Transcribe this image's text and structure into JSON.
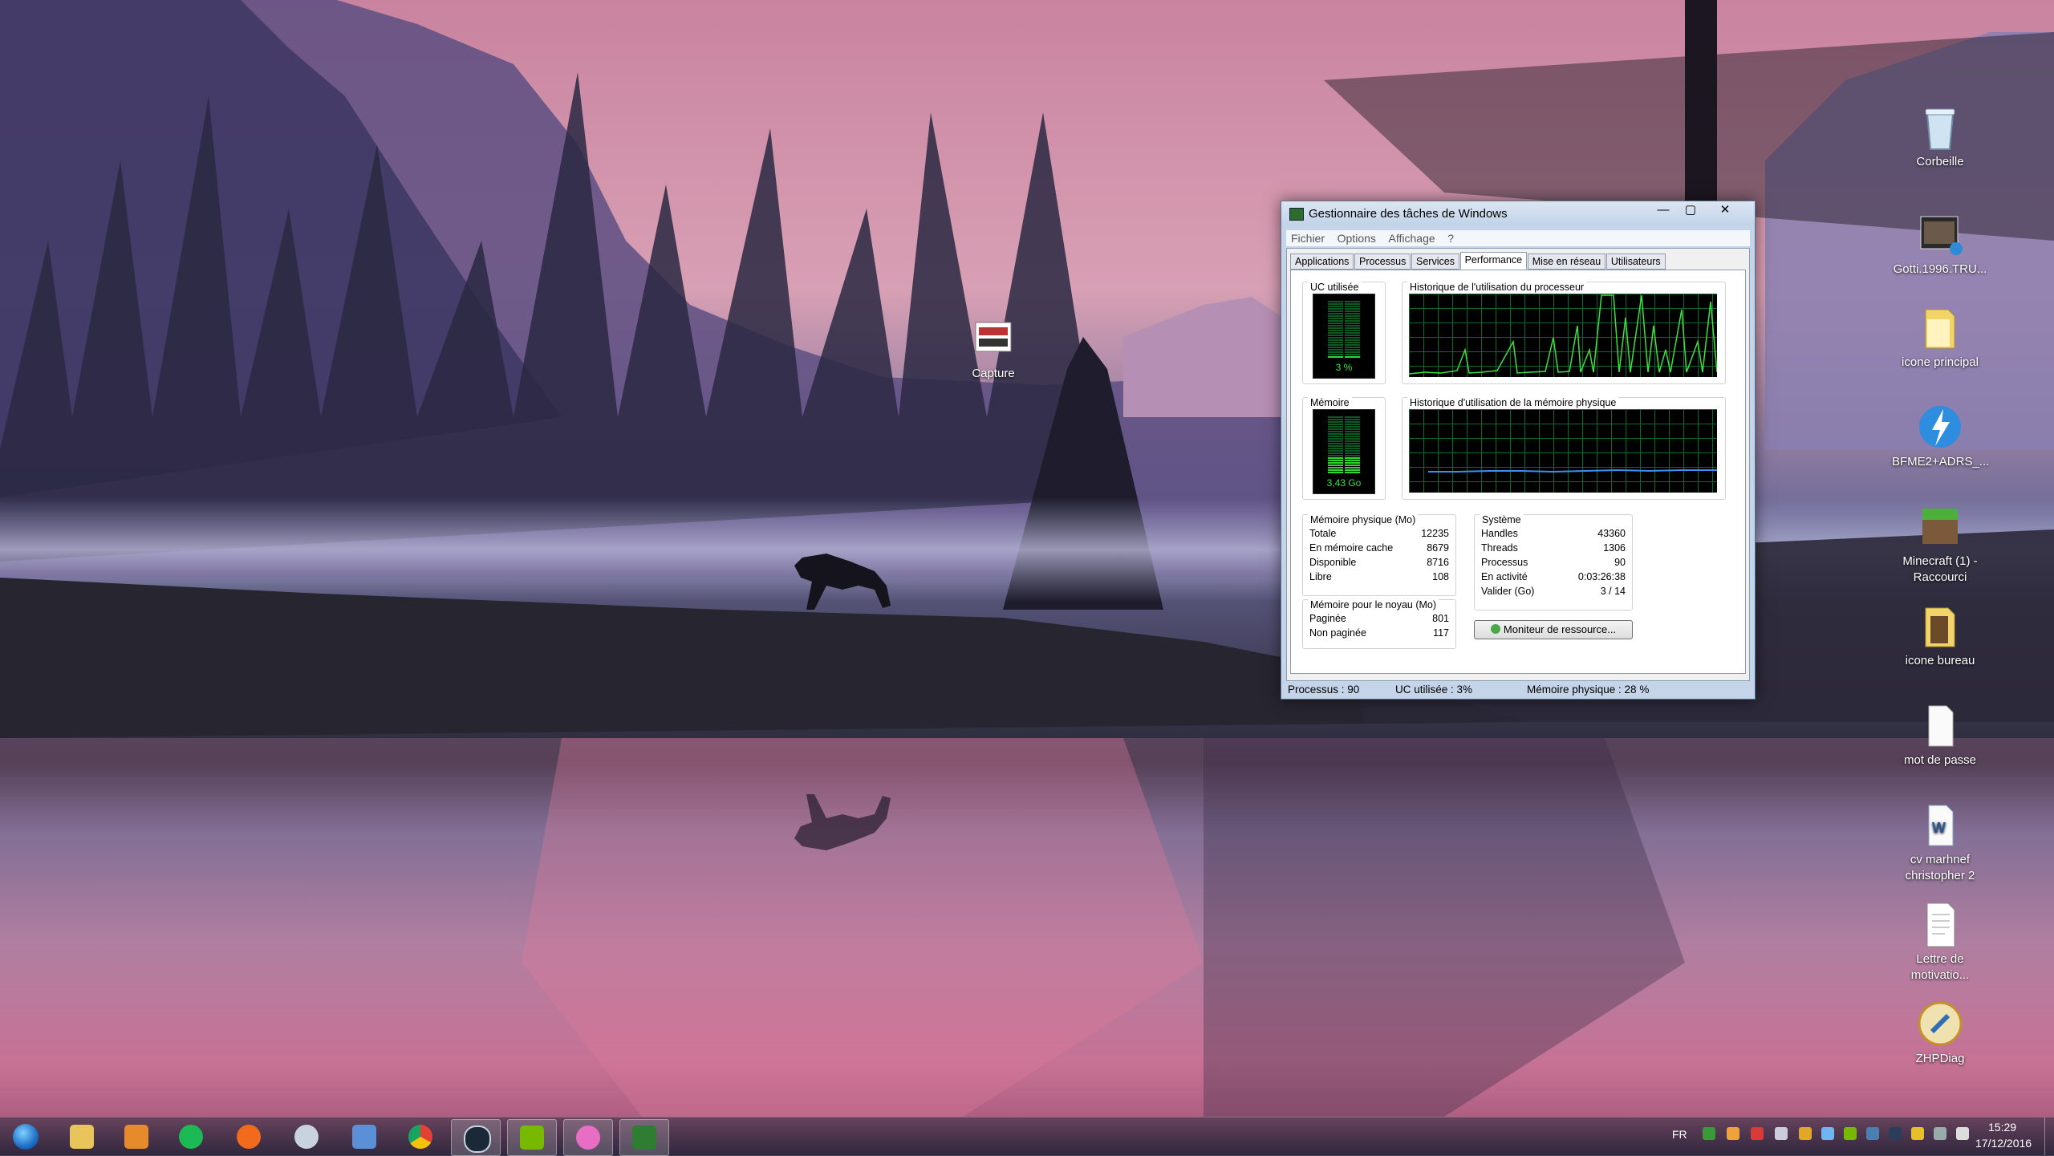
{
  "desktop": {
    "icons": [
      {
        "label": "Corbeille",
        "icon": "recycle-bin-icon"
      },
      {
        "label": "Gotti.1996.TRU...",
        "icon": "video-file-icon"
      },
      {
        "label": "icone principal",
        "icon": "folder-icon"
      },
      {
        "label": "BFME2+ADRS_...",
        "icon": "lightning-app-icon"
      },
      {
        "label": "Minecraft (1) - Raccourci",
        "icon": "minecraft-icon"
      },
      {
        "label": "icone bureau",
        "icon": "folder-icon"
      },
      {
        "label": "mot de passe",
        "icon": "text-file-icon"
      },
      {
        "label": "cv marhnef christopher 2",
        "icon": "word-document-icon"
      },
      {
        "label": "Lettre de motivatio...",
        "icon": "document-icon"
      },
      {
        "label": "ZHPDiag",
        "icon": "zhpdiag-icon"
      },
      {
        "label": "Capture",
        "icon": "screenshot-file-icon"
      }
    ]
  },
  "taskmanager": {
    "title": "Gestionnaire des tâches de Windows",
    "menu": [
      "Fichier",
      "Options",
      "Affichage",
      "?"
    ],
    "tabs": [
      "Applications",
      "Processus",
      "Services",
      "Performance",
      "Mise en réseau",
      "Utilisateurs"
    ],
    "active_tab": "Performance",
    "cpu_label": "UC utilisée",
    "cpu_value": "3 %",
    "cpu_usage_fraction": 0.03,
    "cpu_history_label": "Historique de l'utilisation du processeur",
    "mem_label": "Mémoire",
    "mem_value": "3,43 Go",
    "mem_usage_fraction": 0.28,
    "mem_history_label": "Historique d'utilisation de la mémoire physique",
    "physical_memory": {
      "title": "Mémoire physique (Mo)",
      "rows": [
        {
          "k": "Totale",
          "v": "12235"
        },
        {
          "k": "En mémoire cache",
          "v": "8679"
        },
        {
          "k": "Disponible",
          "v": "8716"
        },
        {
          "k": "Libre",
          "v": "108"
        }
      ]
    },
    "kernel_memory": {
      "title": "Mémoire pour le noyau (Mo)",
      "rows": [
        {
          "k": "Paginée",
          "v": "801"
        },
        {
          "k": "Non paginée",
          "v": "117"
        }
      ]
    },
    "system": {
      "title": "Système",
      "rows": [
        {
          "k": "Handles",
          "v": "43360"
        },
        {
          "k": "Threads",
          "v": "1306"
        },
        {
          "k": "Processus",
          "v": "90"
        },
        {
          "k": "En activité",
          "v": "0:03:26:38"
        },
        {
          "k": "Valider (Go)",
          "v": "3 / 14"
        }
      ]
    },
    "resource_monitor_button": "Moniteur de ressource...",
    "status": {
      "processes": "Processus : 90",
      "cpu": "UC utilisée : 3%",
      "memory": "Mémoire physique : 28 %"
    }
  },
  "taskbar": {
    "items": [
      {
        "icon": "windows-start-icon",
        "color": "#3a8ee6"
      },
      {
        "icon": "file-explorer-icon",
        "color": "#e8c45a"
      },
      {
        "icon": "media-player-icon",
        "color": "#e58b2c"
      },
      {
        "icon": "spotify-icon",
        "color": "#1db954"
      },
      {
        "icon": "origin-icon",
        "color": "#f26b1d"
      },
      {
        "icon": "cyberlink-icon",
        "color": "#c9d3e0"
      },
      {
        "icon": "uplay-icon",
        "color": "#5b8fd6"
      },
      {
        "icon": "chrome-icon",
        "color": "#e34133"
      },
      {
        "icon": "steam-icon",
        "color": "#1b2838"
      },
      {
        "icon": "geforce-icon",
        "color": "#76b900"
      },
      {
        "icon": "itunes-icon",
        "color": "#e86dc4"
      },
      {
        "icon": "task-manager-icon",
        "color": "#2f7d32"
      }
    ],
    "language": "FR",
    "time": "15:29",
    "date": "17/12/2016"
  }
}
